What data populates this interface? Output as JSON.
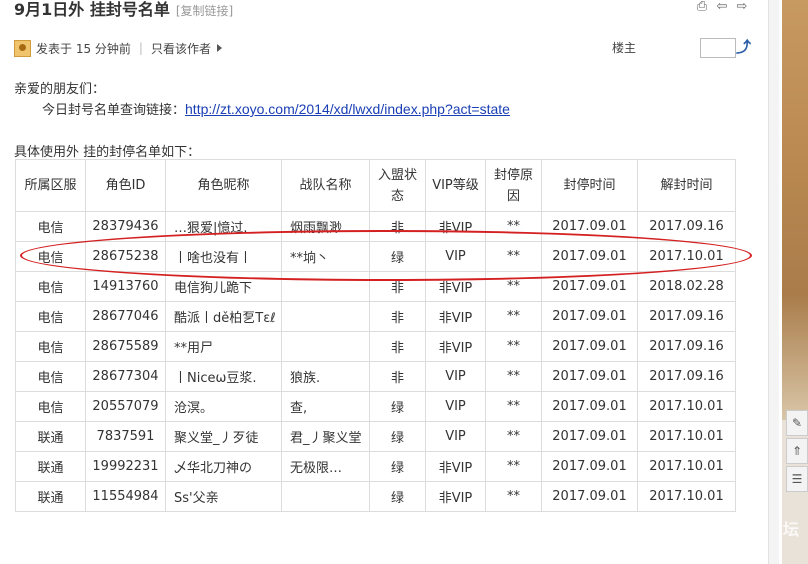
{
  "post": {
    "title": "9月1日外 挂封号名单",
    "copy_link": "[复制链接]",
    "posted": "发表于 15 分钟前",
    "separator": "|",
    "author_only": "只看该作者",
    "floor_label": "楼主"
  },
  "body": {
    "greeting": "亲爱的朋友们：",
    "query_prefix": "今日封号名单查询链接：",
    "query_url": "http://zt.xoyo.com/2014/xd/lwxd/index.php?act=state",
    "intro": "具体使用外 挂的封停名单如下："
  },
  "table": {
    "headers": [
      "所属区服",
      "角色ID",
      "角色昵称",
      "战队名称",
      "入盟状态",
      "VIP等级",
      "封停原因",
      "封停时间",
      "解封时间"
    ],
    "rows": [
      [
        "电信",
        "28379436",
        "…狠爱|憶过.",
        "烟雨飘渺",
        "非",
        "非VIP",
        "**",
        "2017.09.01",
        "2017.09.16"
      ],
      [
        "电信",
        "28675238",
        "丨啥也没有丨",
        "**垧丶",
        "绿",
        "VIP",
        "**",
        "2017.09.01",
        "2017.10.01"
      ],
      [
        "电信",
        "14913760",
        "电信狗儿跪下",
        "",
        "非",
        "非VIP",
        "**",
        "2017.09.01",
        "2018.02.28"
      ],
      [
        "电信",
        "28677046",
        "酷派丨dě柏乭Tεℓ",
        "",
        "非",
        "非VIP",
        "**",
        "2017.09.01",
        "2017.09.16"
      ],
      [
        "电信",
        "28675589",
        "**用尸",
        "",
        "非",
        "非VIP",
        "**",
        "2017.09.01",
        "2017.09.16"
      ],
      [
        "电信",
        "28677304",
        "丨Niceω豆浆.",
        "狼族.",
        "非",
        "VIP",
        "**",
        "2017.09.01",
        "2017.09.16"
      ],
      [
        "电信",
        "20557079",
        "沧溟。",
        "查,",
        "绿",
        "VIP",
        "**",
        "2017.09.01",
        "2017.10.01"
      ],
      [
        "联通",
        "7837591",
        "聚义堂_丿歹徒",
        "君_丿聚义堂",
        "绿",
        "VIP",
        "**",
        "2017.09.01",
        "2017.10.01"
      ],
      [
        "联通",
        "19992231",
        "乄华北刀神の",
        "无极限…",
        "绿",
        "非VIP",
        "**",
        "2017.09.01",
        "2017.10.01"
      ],
      [
        "联通",
        "11554984",
        "Ss'父亲",
        "",
        "绿",
        "非VIP",
        "**",
        "2017.09.01",
        "2017.10.01"
      ]
    ]
  },
  "icons": [
    "print-icon",
    "prev-icon",
    "next-icon",
    "user-avatar-icon",
    "arrow-right-icon",
    "goto-floor-icon"
  ],
  "colors": {
    "link": "#1a3fb5",
    "highlight_oval": "#d42020",
    "border": "#dcdcdc"
  },
  "watermark": "坛"
}
